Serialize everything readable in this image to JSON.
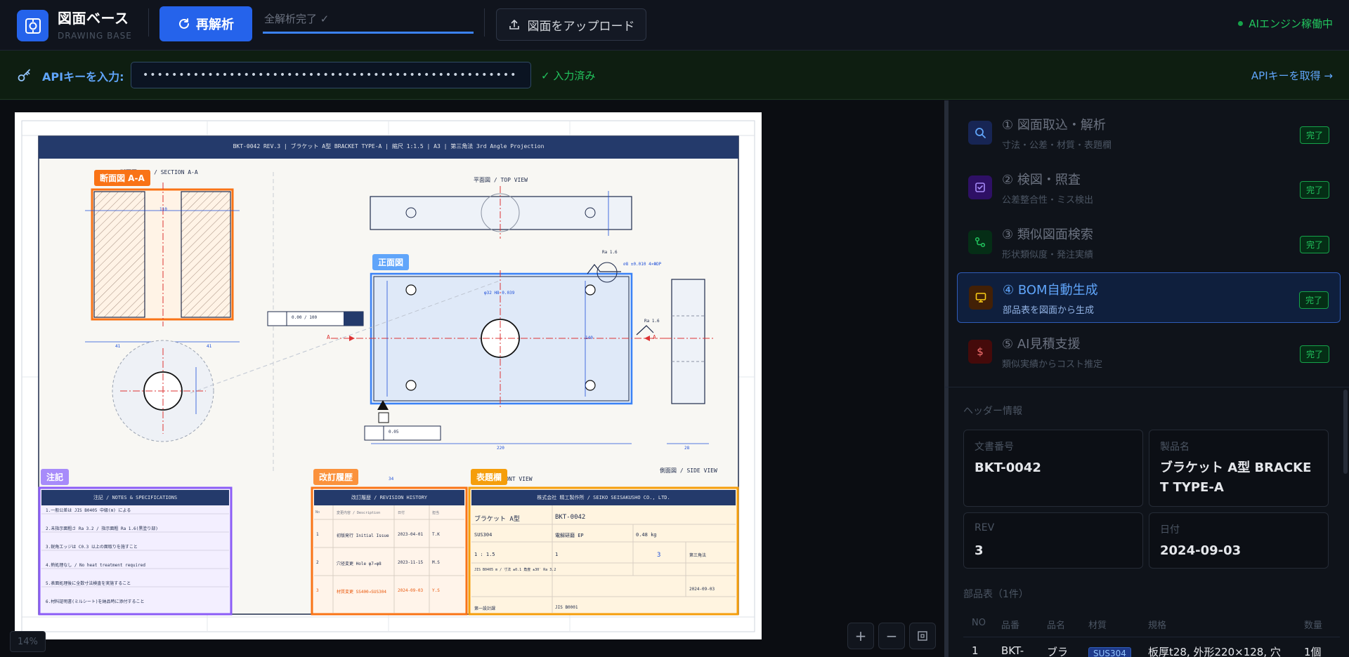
{
  "app": {
    "title": "図面ベース",
    "subtitle": "DRAWING BASE",
    "reanalyze_label": "再解析",
    "status_text": "全解析完了 ✓",
    "upload_label": "図面をアップロード",
    "engine_status": "AIエンジン稼働中"
  },
  "api": {
    "label": "APIキーを入力:",
    "masked_value": "••••••••••••••••••••••••••••••••••••••••••••••••••••",
    "status": "✓ 入力済み",
    "get_key_link": "APIキーを取得 →"
  },
  "canvas": {
    "zoom": "14%",
    "zoom_in": "+",
    "zoom_out": "−"
  },
  "drawing": {
    "title_bar": "BKT-0042  REV.3  |  ブラケット A型  BRACKET TYPE-A  |  縮尺 1:1.5  |  A3  |  第三角法  3rd Angle Projection",
    "section_label": "断面図 A-A  /  SECTION A-A",
    "top_view_label": "平面図  /  TOP VIEW",
    "front_view_label": "正面図  /  FRONT VIEW",
    "side_view_label": "側面図  /  SIDE VIEW",
    "tags": {
      "section": "断面図 A-A",
      "front": "正面図",
      "notes": "注記",
      "revision": "改訂履歴",
      "titleblock": "表題欄"
    },
    "notes_title": "注記  /  NOTES & SPECIFICATIONS",
    "notes": [
      "1.一般公差は JIS B0405 中級(m) による",
      "2.未指示面粗さ Ra 3.2  /  指示面粗 Ra 1.6(黒塗り部)",
      "3.鋭角エッジは C0.3 以上の面取りを施すこと",
      "4.熱処理なし  /  No heat treatment required",
      "5.表面処理後に全数寸法検査を実施すること",
      "6.材料証明書(ミルシート)を納品時に添付すること"
    ],
    "revision_title": "改訂履歴  /  REVISION HISTORY",
    "revision_cols": [
      "No",
      "変更内容 / Description",
      "日付",
      "担当"
    ],
    "revisions": [
      {
        "no": "1",
        "desc": "初版発行  Initial Issue",
        "date": "2023-04-01",
        "by": "T.K"
      },
      {
        "no": "2",
        "desc": "穴径変更  Hole φ7→φ8",
        "date": "2023-11-15",
        "by": "M.S"
      },
      {
        "no": "3",
        "desc": "材質変更  SS400→SUS304",
        "date": "2024-09-03",
        "by": "Y.S"
      }
    ],
    "titleblock_title": "株式会社 精工製作所  /  SEIKO SEISAKUSHO CO., LTD.",
    "tb": {
      "part_name": "ブラケット A型",
      "doc_no": "BKT-0042",
      "material": "SUS304",
      "finish": "電解研磨 EP",
      "weight": "0.48 kg",
      "scale": "1 : 1.5",
      "qty": "1",
      "rev": "3",
      "projection": "第三角法",
      "tolerance": "JIS B0405 m  /  寸法 ±0.1  角度 ±30′  Ra 3.2",
      "date": "2024-09-03",
      "dept": "第一設計課",
      "standard": "JIS B0001"
    },
    "dims": {
      "d110": "110",
      "d41a": "41",
      "d41b": "41",
      "d220": "220",
      "d28": "28",
      "d34": "34",
      "d140": "140",
      "tol1": "0.00 / 100",
      "tol2": "0.05",
      "hole": "φ32  H8  0.039",
      "ra1": "Ra 1.6",
      "ra2": "Ra 1.6",
      "flat": "⌀8  ±0.010  4×ΦDP",
      "a1": "A",
      "a2": "A"
    }
  },
  "steps": [
    {
      "title": "① 図面取込・解析",
      "sub": "寸法・公差・材質・表題欄",
      "status": "完了"
    },
    {
      "title": "② 検図・照査",
      "sub": "公差整合性・ミス検出",
      "status": "完了"
    },
    {
      "title": "③ 類似図面検索",
      "sub": "形状類似度・発注実績",
      "status": "完了"
    },
    {
      "title": "④ BOM自動生成",
      "sub": "部品表を図面から生成",
      "status": "完了"
    },
    {
      "title": "⑤ AI見積支援",
      "sub": "類似実績からコスト推定",
      "status": "完了"
    }
  ],
  "header_info": {
    "label": "ヘッダー情報",
    "doc_no_label": "文書番号",
    "doc_no": "BKT-0042",
    "product_label": "製品名",
    "product": "ブラケット A型 BRACKET TYPE-A",
    "rev_label": "REV",
    "rev": "3",
    "date_label": "日付",
    "date": "2024-09-03"
  },
  "bom": {
    "label": "部品表（1件）",
    "columns": [
      "NO",
      "品番",
      "品名",
      "材質",
      "規格",
      "数量"
    ],
    "rows": [
      {
        "no": "1",
        "part_no": "BKT-",
        "name": "ブラ",
        "material": "SUS304",
        "spec": "板厚t28, 外形220×128, 穴",
        "qty": "1個"
      }
    ]
  },
  "colors": {
    "accent": "#2563eb",
    "success": "#22c55e",
    "section_tag": "#f97316",
    "front_tag": "#60a5fa",
    "notes_tag": "#a78bfa",
    "revision_tag": "#fb923c",
    "titleblock_tag": "#f59e0b"
  }
}
